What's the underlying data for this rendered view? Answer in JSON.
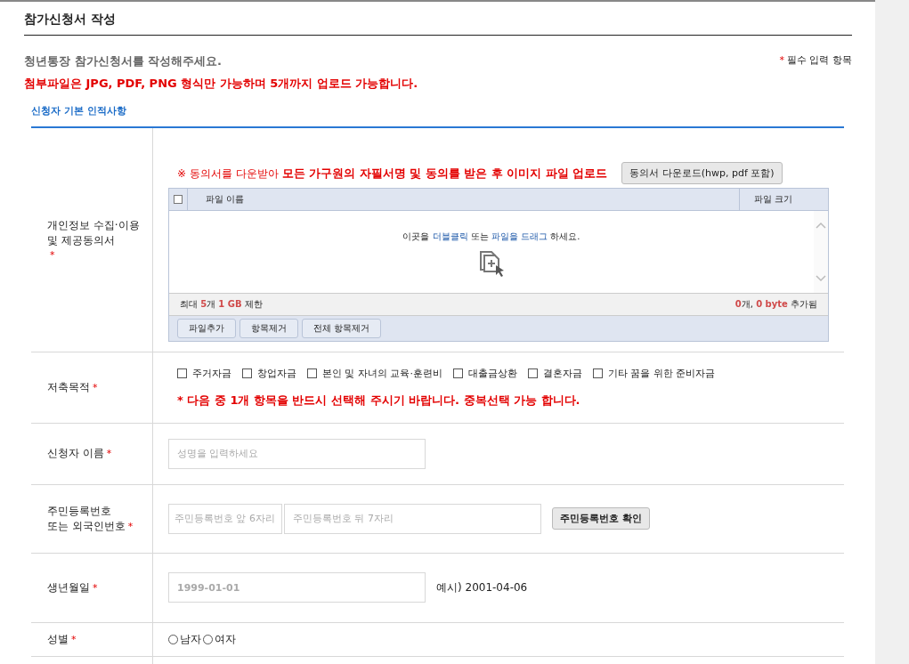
{
  "page": {
    "title": "참가신청서 작성",
    "intro": "청년통장 참가신청서를 작성해주세요.",
    "notice": "첨부파일은 JPG, PDF, PNG 형식만 가능하며 5개까지 업로드 가능합니다.",
    "legend_mark": "*",
    "legend": "필수 입력 항목"
  },
  "section": {
    "title": "신청자 기본 인적사항"
  },
  "consent": {
    "label": "개인정보 수집·이용 및 제공동의서",
    "required_mark": "*",
    "instruction": "※ 동의서를 다운받아 **모든 가구원의 자필서명 및 동의를 받은 후  이미지 파일 업로드**",
    "download_button": "동의서 다운로드(hwp, pdf 포함)",
    "uploader": {
      "select_all_checked": false,
      "columns": [
        "파일 이름",
        "파일 크기"
      ],
      "hint": [
        {
          "text": "이곳을 ",
          "kind": "plain"
        },
        {
          "text": "더블클릭",
          "kind": "link"
        },
        {
          "text": " 또는 ",
          "kind": "plain"
        },
        {
          "text": "파일을 드래그",
          "kind": "link"
        },
        {
          "text": " 하세요.",
          "kind": "plain"
        }
      ],
      "limit": [
        {
          "text": "최대 ",
          "kind": "plain"
        },
        {
          "text": "5",
          "kind": "number"
        },
        {
          "text": "개 ",
          "kind": "plain"
        },
        {
          "text": "1 GB",
          "kind": "number"
        },
        {
          "text": " 제한",
          "kind": "plain"
        }
      ],
      "added": [
        {
          "text": "0",
          "kind": "number"
        },
        {
          "text": "개, ",
          "kind": "plain"
        },
        {
          "text": "0 byte",
          "kind": "number"
        },
        {
          "text": " 추가됨",
          "kind": "plain"
        }
      ],
      "buttons": [
        "파일추가",
        "항목제거",
        "전체 항목제거"
      ]
    }
  },
  "purpose": {
    "label": "저축목적",
    "required_mark": "*",
    "options": [
      {
        "label": "주거자금",
        "checked": false
      },
      {
        "label": "창업자금",
        "checked": false
      },
      {
        "label": "본인 및 자녀의 교육·훈련비",
        "checked": false
      },
      {
        "label": "대출금상환",
        "checked": false
      },
      {
        "label": "결혼자금",
        "checked": false
      },
      {
        "label": "기타 꿈을 위한 준비자금",
        "checked": false
      }
    ],
    "note": "* 다음 중 1개 항목을 반드시 선택해 주시기 바랍니다.  중복선택 가능 합니다."
  },
  "name": {
    "label": "신청자 이름",
    "required_mark": "*",
    "placeholder": "성명을 입력하세요"
  },
  "id_number": {
    "label_lines": [
      "주민등록번호",
      "또는 외국인번호"
    ],
    "required_mark": "*",
    "front_placeholder": "주민등록번호 앞 6자리",
    "back_placeholder": "주민등록번호 뒤 7자리",
    "button": "주민등록번호 확인"
  },
  "birth": {
    "label": "생년월일",
    "required_mark": "*",
    "placeholder": "1999-01-01",
    "example": "예시) 2001-04-06"
  },
  "gender": {
    "label": "성별",
    "required_mark": "*",
    "options": [
      {
        "label": "남자",
        "selected": false
      },
      {
        "label": "여자",
        "selected": false
      }
    ]
  }
}
